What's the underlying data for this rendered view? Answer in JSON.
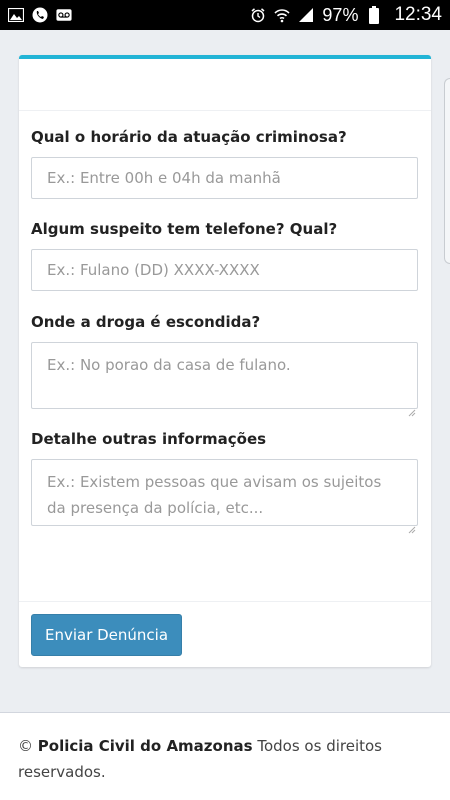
{
  "status_bar": {
    "battery_text": "97%",
    "time": "12:34",
    "icons": [
      "image-icon",
      "phone-icon",
      "voicemail-icon",
      "alarm-icon",
      "wifi-icon",
      "signal-icon",
      "battery-icon"
    ]
  },
  "form": {
    "fields": [
      {
        "label": "Qual o horário da atuação criminosa?",
        "placeholder": "Ex.: Entre 00h e 04h da manhã"
      },
      {
        "label": "Algum suspeito tem telefone? Qual?",
        "placeholder": "Ex.: Fulano (DD) XXXX-XXXX"
      },
      {
        "label": "Onde a droga é escondida?",
        "placeholder": "Ex.: No porao da casa de fulano."
      },
      {
        "label": "Detalhe outras informações",
        "placeholder": "Ex.: Existem pessoas que avisam os sujeitos da presença da polícia, etc..."
      }
    ],
    "submit_label": "Enviar Denúncia"
  },
  "footer": {
    "copyright": "©",
    "org": "Policia Civil do Amazonas",
    "rights": "Todos os direitos reservados."
  },
  "colors": {
    "accent_top": "#22b4d6",
    "button": "#3c8dbc",
    "page_bg": "#ebeef2"
  }
}
